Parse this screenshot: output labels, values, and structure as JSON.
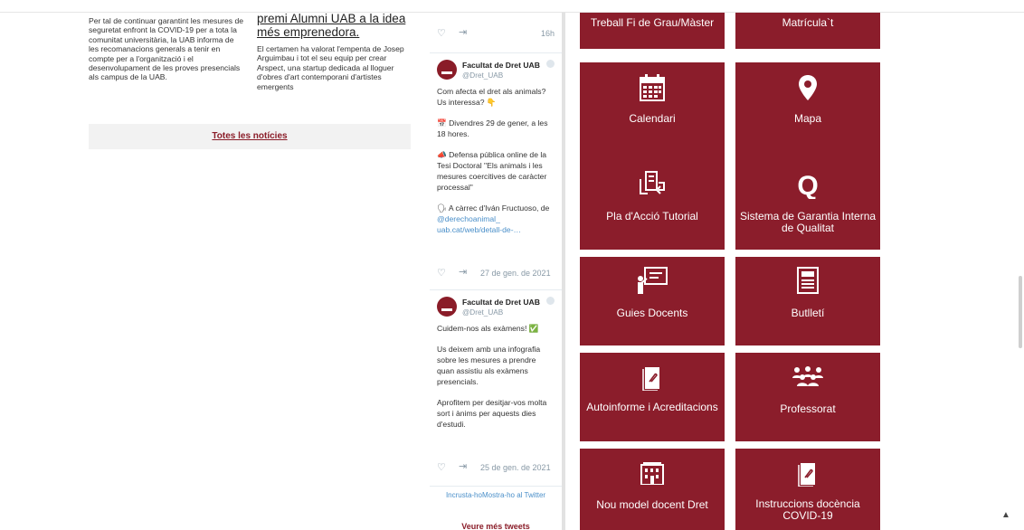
{
  "news": {
    "left_text": "Per tal de continuar garantint les mesures de seguretat enfront la COVID-19 per a tota la comunitat universitària, la UAB informa de les recomanacions generals a tenir en compte per a l'organització i el desenvolupament de les proves presencials als campus de la UAB.",
    "right_title": "premi Alumni UAB a la idea més emprenedora.",
    "right_desc": "El certamen ha valorat l'empenta de Josep Arguimbau i tot el seu equip per crear Arspect, una startup dedicada al lloguer d'obres d'art contemporani d'artistes emergents",
    "all_news_label": "Totes les notícies"
  },
  "twitter": {
    "first_time": "16h",
    "tweets": [
      {
        "name": "Facultat de Dret UAB",
        "handle": "@Dret_UAB",
        "paragraphs": [
          "Com afecta el dret als animals? Us interessa? 👇",
          "📅 Divendres 29 de gener, a les 18 hores.",
          "📣 Defensa pública online de la Tesi Doctoral \"Els animals i les mesures coercitives de caràcter processal\"",
          "🗣 A càrrec d'Iván Fructuoso, de "
        ],
        "link_1": "@derechoanimal_",
        "link_2": "uab.cat/web/detall-de-…",
        "date": "27 de gen. de 2021"
      },
      {
        "name": "Facultat de Dret UAB",
        "handle": "@Dret_UAB",
        "paragraphs": [
          "Cuidem-nos als exàmens! ✅",
          "Us deixem amb una infografia sobre les mesures a prendre quan assistiu als exàmens presencials.",
          "Aprofitem per desitjar-vos molta sort i ànims per aquests dies d'estudi."
        ],
        "date": "25 de gen. de 2021"
      }
    ],
    "footer": "Incrusta-hoMostra-ho al Twitter",
    "more_label": "Veure més tweets"
  },
  "tiles": {
    "tfg": "Treball Fi de Grau/Màster",
    "matricula": "Matrícula`t",
    "calendari": "Calendari",
    "mapa": "Mapa",
    "pat": "Pla d'Acció Tutorial",
    "sgiq": "Sistema de Garantia Interna de Qualitat",
    "guies": "Guies Docents",
    "butlleti": "Butlletí",
    "autoinforme": "Autoinforme i Acreditacions",
    "professorat": "Professorat",
    "nou_model": "Nou model docent Dret",
    "instruccions": "Instruccions docència COVID-19"
  },
  "colors": {
    "tile_bg": "#8b1d2b",
    "link": "#4a8fc9",
    "accent": "#8a1c28"
  }
}
